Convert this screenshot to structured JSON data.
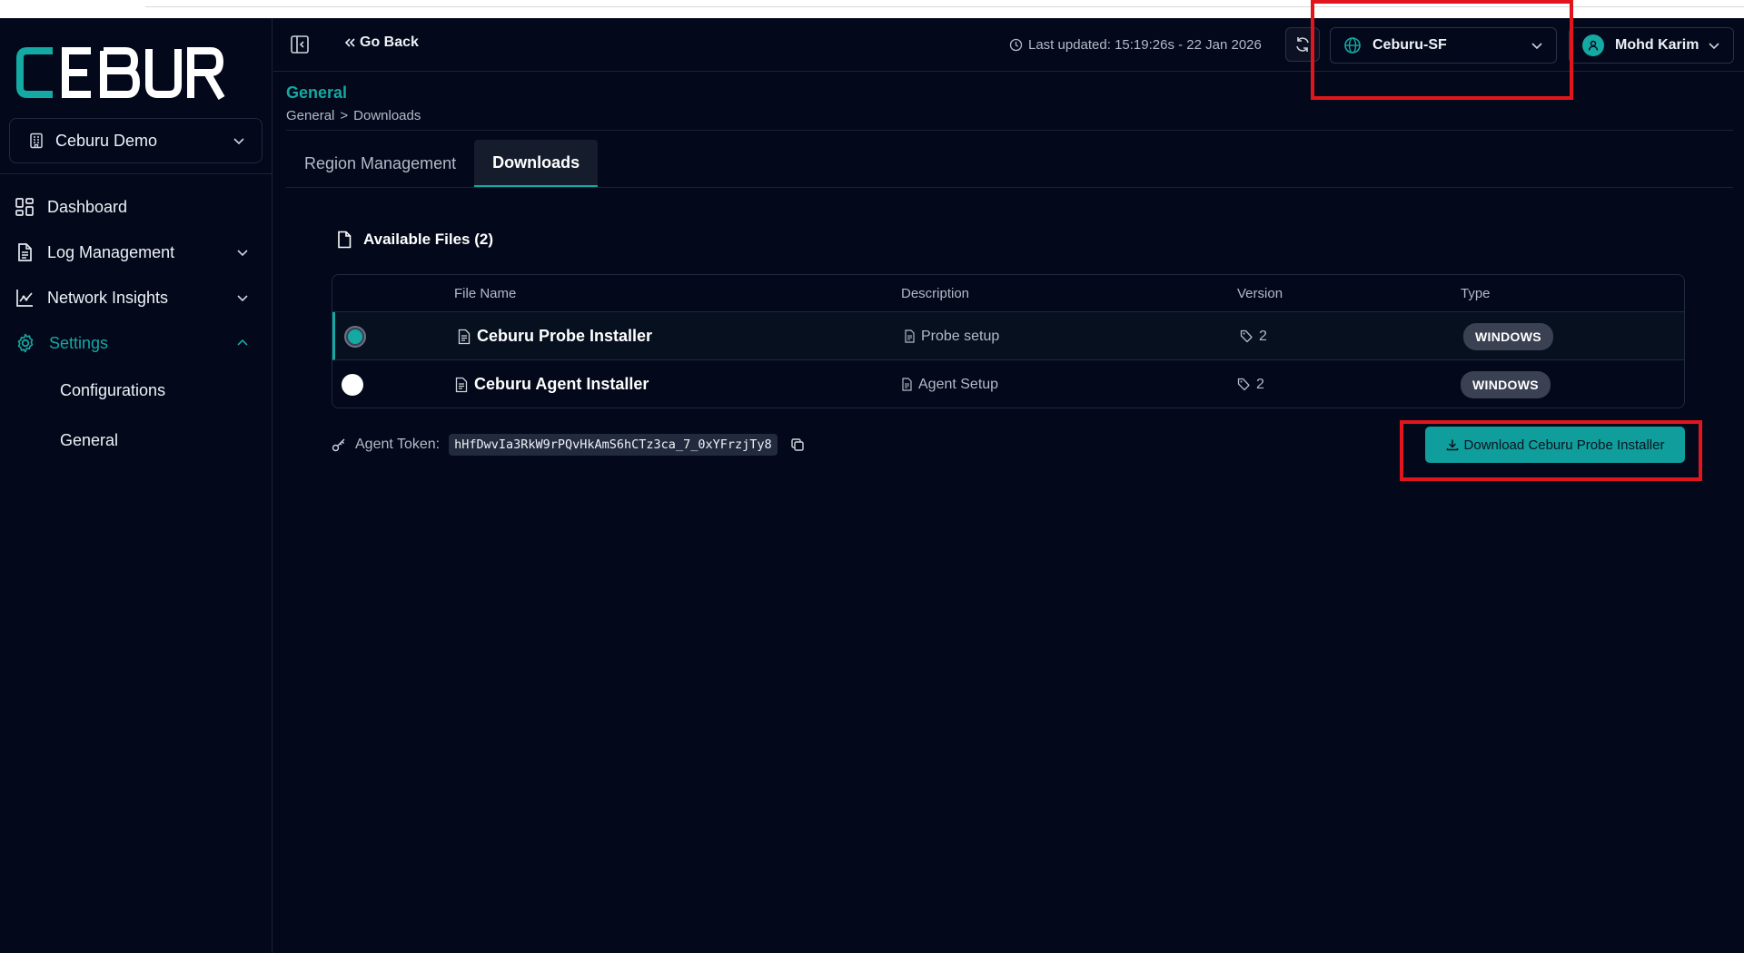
{
  "app": {
    "logo_text": "CEBURU"
  },
  "org_select": {
    "label": "Ceburu Demo"
  },
  "sidebar": {
    "items": [
      {
        "label": "Dashboard",
        "icon": "dashboard-icon"
      },
      {
        "label": "Log Management",
        "icon": "document-icon"
      },
      {
        "label": "Network Insights",
        "icon": "chart-icon"
      },
      {
        "label": "Settings",
        "icon": "gear-icon"
      }
    ],
    "settings_sub": [
      "Configurations",
      "General"
    ]
  },
  "header": {
    "go_back": "Go Back",
    "last_updated": "Last updated: 15:19:26s - 22 Jan 2026",
    "region": "Ceburu-SF",
    "user": "Mohd Karim"
  },
  "page": {
    "title": "General",
    "breadcrumb": [
      "General",
      ">",
      "Downloads"
    ]
  },
  "tabs": [
    "Region Management",
    "Downloads"
  ],
  "files": {
    "heading": "Available Files (2)",
    "columns": [
      "File Name",
      "Description",
      "Version",
      "Type"
    ],
    "rows": [
      {
        "name": "Ceburu Probe Installer",
        "description": "Probe setup",
        "version": "2",
        "type": "WINDOWS",
        "selected": true
      },
      {
        "name": "Ceburu Agent Installer",
        "description": "Agent Setup",
        "version": "2",
        "type": "WINDOWS",
        "selected": false
      }
    ]
  },
  "token": {
    "label": "Agent Token:",
    "value": "hHfDwvIa3RkW9rPQvHkAmS6hCTz3ca_7_0xYFrzjTy8"
  },
  "download_button": "Download Ceburu Probe Installer",
  "colors": {
    "accent": "#14a9a3",
    "background": "#03081a",
    "highlight": "#e0161c"
  }
}
